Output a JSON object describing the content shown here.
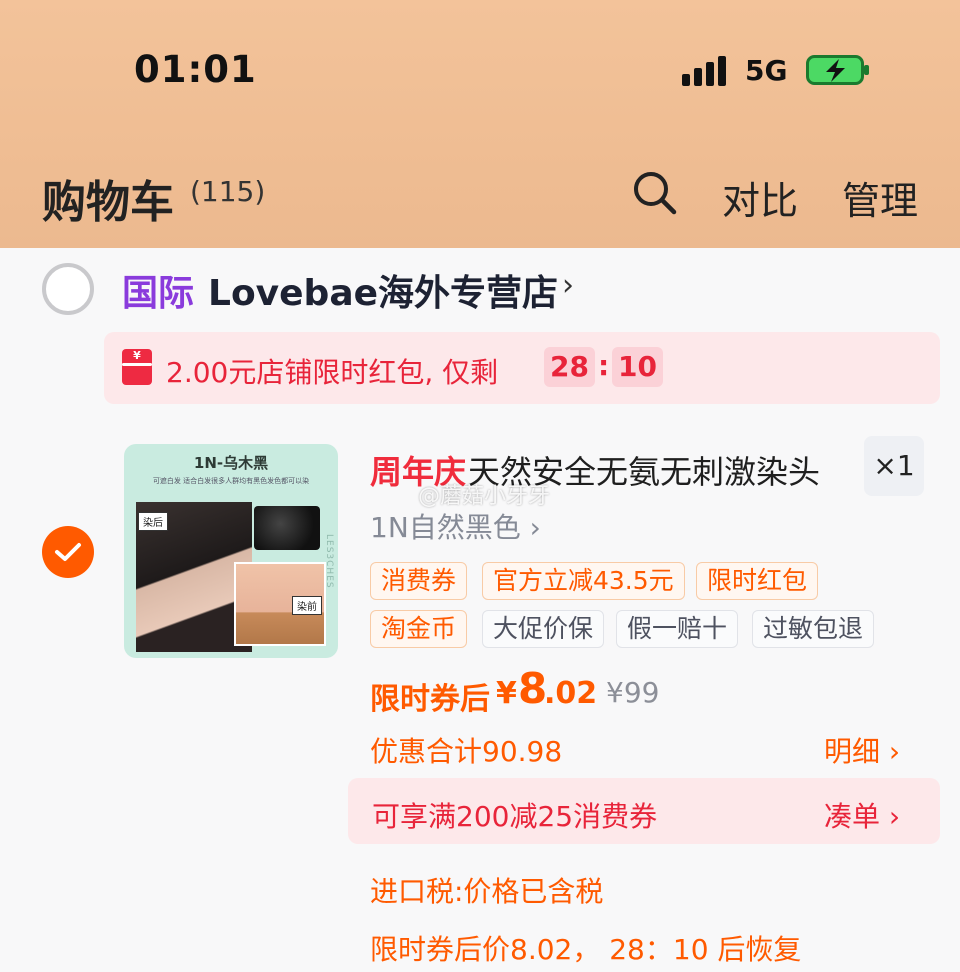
{
  "status_bar": {
    "time": "01:01",
    "network": "5G"
  },
  "header": {
    "title": "购物车",
    "count": "(115)",
    "compare_label": "对比",
    "manage_label": "管理"
  },
  "shop": {
    "tag": "国际",
    "name": "Lovebae海外专营店",
    "chevron": "›"
  },
  "shop_promo": {
    "text": "2.00元店铺限时红包, 仅剩",
    "countdown_minutes": "28",
    "countdown_seconds": "10",
    "separator": ":"
  },
  "item": {
    "image": {
      "title": "1N-乌木黑",
      "subtitle": "可遮白发 适合白发很多人群均有黑色发色都可以染",
      "label_after": "染后",
      "label_before": "染前",
      "side_text": "LES3CHES"
    },
    "event_tag": "周年庆",
    "title": "天然安全无氨无刺激染头",
    "quantity": "×1",
    "variant": "1N自然黑色 ›",
    "badges_row1": [
      "消费券",
      "官方立减43.5元",
      "限时红包"
    ],
    "badges_row2_orange": [
      "淘金币"
    ],
    "badges_row2_grey": [
      "大促价保",
      "假一赔十",
      "过敏包退"
    ],
    "price_label": "限时券后",
    "currency": "¥",
    "price_int": "8",
    "price_dec": ".02",
    "original_price": "¥99",
    "discount_total": "优惠合计90.98",
    "detail_link": "明细 ›",
    "coupon_text": "可享满200减25消费券",
    "coupon_link": "凑单 ›",
    "tax_note": "进口税:价格已含税",
    "restore_note": "限时券后价8.02， 28：10 后恢复"
  },
  "watermark": "@蘑菇小牙牙"
}
